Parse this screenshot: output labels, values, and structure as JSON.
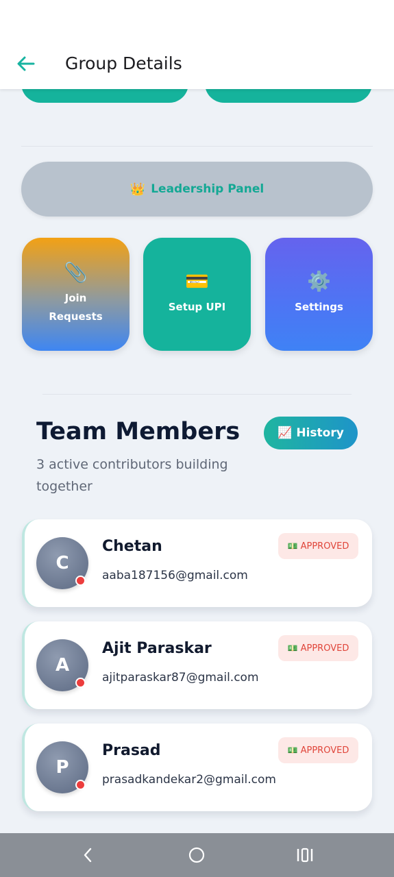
{
  "header": {
    "title": "Group Details",
    "back_icon": "arrow-left-icon"
  },
  "leadership_panel": {
    "icon": "👑",
    "label": "Leadership Panel"
  },
  "action_tiles": [
    {
      "icon": "📎",
      "label_line1": "Join",
      "label_line2": "Requests"
    },
    {
      "icon": "💳",
      "label": "Setup UPI"
    },
    {
      "icon": "⚙️",
      "label": "Settings"
    }
  ],
  "team": {
    "title": "Team Members",
    "subtitle": "3 active contributors building together",
    "history_icon": "📈",
    "history_label": "History",
    "members": [
      {
        "initial": "C",
        "name": "Chetan",
        "email": "aaba187156@gmail.com",
        "status_icon": "💵",
        "status": "APPROVED"
      },
      {
        "initial": "A",
        "name": "Ajit Paraskar",
        "email": "ajitparaskar87@gmail.com",
        "status_icon": "💵",
        "status": "APPROVED"
      },
      {
        "initial": "P",
        "name": "Prasad",
        "email": "prasadkandekar2@gmail.com",
        "status_icon": "💵",
        "status": "APPROVED"
      }
    ]
  },
  "colors": {
    "accent": "#15b39c",
    "background": "#eef2f7",
    "status_dot": "#ec3d3d",
    "badge_text": "#e0453a"
  },
  "system_nav": {
    "back_icon": "nav-back-icon",
    "home_icon": "nav-home-icon",
    "recents_icon": "nav-recents-icon"
  }
}
